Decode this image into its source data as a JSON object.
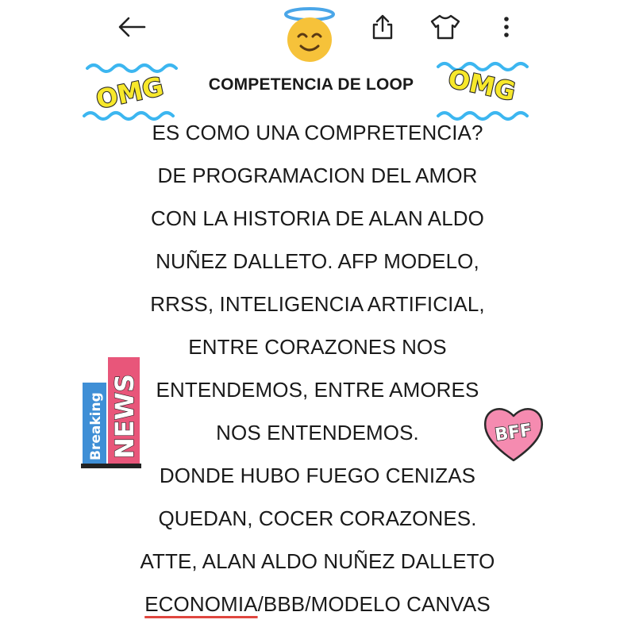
{
  "toolbar": {
    "back_icon": "arrow-left-icon",
    "emoji_icon": "smiling-face-with-halo",
    "share_icon": "share-icon",
    "shirt_icon": "t-shirt-icon",
    "more_icon": "more-vertical-icon"
  },
  "stickers": {
    "omg_left": "OMG",
    "omg_right": "OMG",
    "news_breaking": "Breaking",
    "news_news": "NEWS",
    "bff": "BFF"
  },
  "post": {
    "title": "COMPETENCIA DE LOOP",
    "lines": [
      "ES COMO UNA COMPRETENCIA?",
      "DE PROGRAMACION DEL AMOR",
      "CON LA HISTORIA DE ALAN ALDO",
      "NUÑEZ DALLETO. AFP MODELO,",
      "RRSS, INTELIGENCIA ARTIFICIAL,",
      "ENTRE CORAZONES NOS",
      "ENTENDEMOS, ENTRE AMORES",
      "NOS ENTENDEMOS.",
      "DONDE HUBO FUEGO CENIZAS",
      "QUEDAN, COCER CORAZONES.",
      "ATTE, ALAN ALDO NUÑEZ DALLETO"
    ],
    "last_line": {
      "link": "ECONOMIA",
      "rest": "/BBB/MODELO CANVAS"
    }
  },
  "colors": {
    "omg_fill": "#f7e82b",
    "omg_wave": "#3cb6f0",
    "news_pink": "#e8567a",
    "news_blue": "#3f8fd6",
    "bff_pink": "#f58bb0",
    "link_underline": "#e0463f"
  }
}
